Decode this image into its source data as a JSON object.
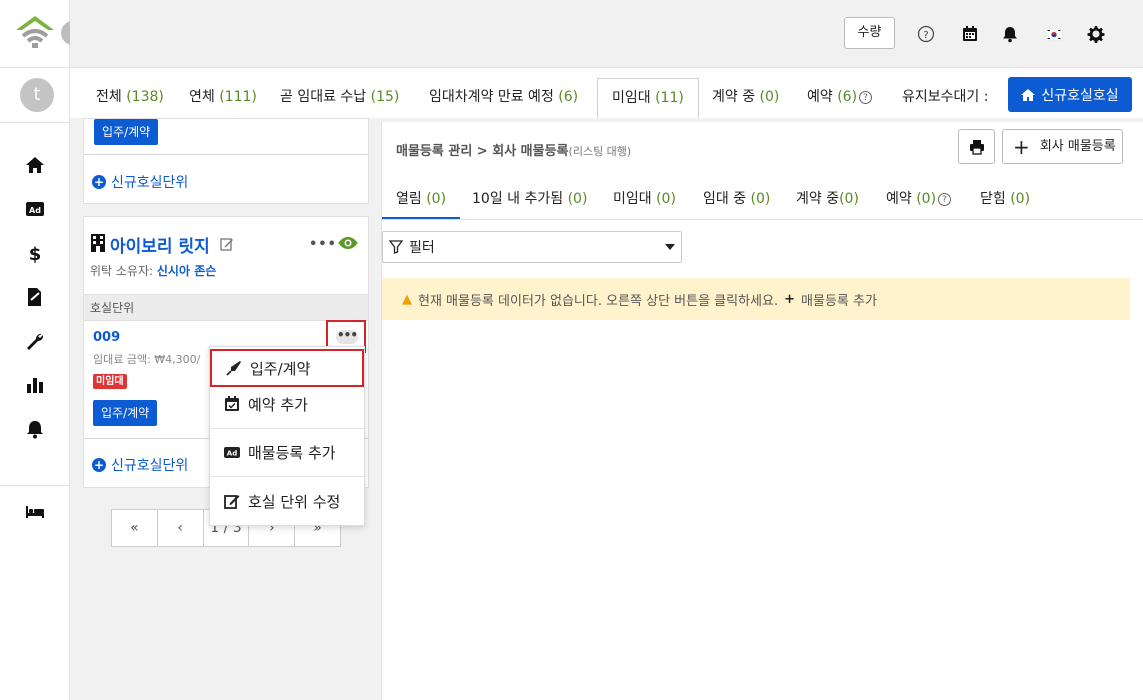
{
  "header": {
    "qty_label": "수량",
    "lang_flag": "kr-flag"
  },
  "rail": {
    "avatar_letter": "t",
    "icons": [
      "home-icon",
      "ad-icon",
      "dollar-icon",
      "contract-icon",
      "wrench-icon",
      "chart-icon",
      "bell-icon",
      "bed-icon"
    ]
  },
  "tabs": [
    {
      "label": "전체",
      "count": "(138)"
    },
    {
      "label": "연체",
      "count": "(111)"
    },
    {
      "label": "곧 임대료 수납",
      "count": "(15)"
    },
    {
      "label": "임대차계약 만료 예정",
      "count": "(6)"
    },
    {
      "label": "미임대",
      "count": "(11)"
    },
    {
      "label": "계약 중",
      "count": "(0)"
    },
    {
      "label": "예약",
      "count": "(6)"
    },
    {
      "label": "유지보수대기 :",
      "count": ""
    }
  ],
  "new_room_label": "신규호실호실",
  "top_card": {
    "move_in_label": "입주/계약",
    "add_unit_label": "신규호실단위"
  },
  "property": {
    "name": "아이보리 릿지",
    "owner_label": "위탁 소유자:",
    "owner_name": "신시아 존슨",
    "unit_section": "호실단위",
    "unit_no": "009",
    "rent_label": "임대료 금액: ₩4,300/",
    "status_badge": "미임대",
    "move_in_label": "입주/계약",
    "add_unit_label": "신규호실단위",
    "more_label": "•••"
  },
  "pager": {
    "first": "«",
    "prev": "‹",
    "page": "1 / 3",
    "next": "›",
    "last": "»"
  },
  "menu": {
    "items": [
      "입주/계약",
      "예약 추가",
      "매물등록 추가",
      "호실 단위 수정"
    ]
  },
  "panel": {
    "breadcrumb": "매물등록 관리 > 회사 매물등록",
    "breadcrumb_sub": "(리스팅 대행)",
    "listing_btn": "회사 매물등록",
    "subtabs": [
      {
        "label": "열림",
        "count": "(0)"
      },
      {
        "label": "10일 내 추가됨",
        "count": "(0)"
      },
      {
        "label": "미임대",
        "count": "(0)"
      },
      {
        "label": "임대 중",
        "count": "(0)"
      },
      {
        "label": "계약 중",
        "count": "(0)"
      },
      {
        "label": "예약",
        "count": "(0)"
      },
      {
        "label": "닫힘",
        "count": "(0)"
      }
    ],
    "filter_label": "필터",
    "alert_text": "현재 매물등록 데이터가 없습니다. 오른쪽 상단 버튼을 클릭하세요.",
    "alert_action": "매물등록 추가"
  }
}
